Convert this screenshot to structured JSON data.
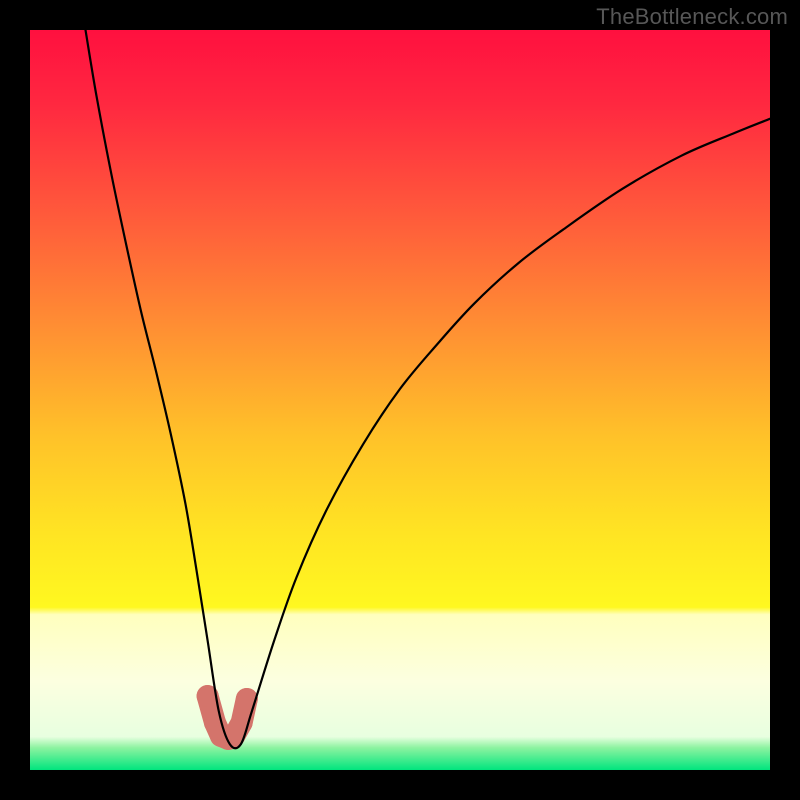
{
  "watermark": "TheBottleneck.com",
  "chart_data": {
    "type": "line",
    "title": "",
    "xlabel": "",
    "ylabel": "",
    "xlim": [
      0,
      100
    ],
    "ylim": [
      0,
      100
    ],
    "background": {
      "kind": "vertical-gradient",
      "stops": [
        {
          "offset": 0.0,
          "color": "#ff103f"
        },
        {
          "offset": 0.1,
          "color": "#ff2840"
        },
        {
          "offset": 0.25,
          "color": "#ff5a3b"
        },
        {
          "offset": 0.4,
          "color": "#ff8e33"
        },
        {
          "offset": 0.55,
          "color": "#ffc229"
        },
        {
          "offset": 0.68,
          "color": "#ffe423"
        },
        {
          "offset": 0.78,
          "color": "#fff820"
        },
        {
          "offset": 0.79,
          "color": "#ffffbe"
        },
        {
          "offset": 0.88,
          "color": "#fcffe0"
        },
        {
          "offset": 0.955,
          "color": "#e8ffe0"
        },
        {
          "offset": 0.97,
          "color": "#8cf3a0"
        },
        {
          "offset": 1.0,
          "color": "#00e57e"
        }
      ]
    },
    "series": [
      {
        "name": "bottleneck-curve",
        "color": "#000000",
        "stroke_width": 2.2,
        "x": [
          7.5,
          9,
          11,
          13,
          15,
          17,
          19,
          21,
          22.5,
          24,
          25.5,
          27,
          28.5,
          30,
          33,
          36,
          40,
          45,
          50,
          55,
          60,
          66,
          72,
          80,
          88,
          95,
          100
        ],
        "y": [
          100,
          91,
          80.5,
          71,
          62,
          54,
          45.5,
          36,
          27,
          17.5,
          8,
          3.5,
          3.5,
          8,
          17.5,
          26,
          35,
          44,
          51.5,
          57.5,
          63,
          68.5,
          73,
          78.5,
          83,
          86,
          88
        ]
      }
    ],
    "highlight": {
      "name": "bottleneck-minimum-band",
      "color": "#d4746b",
      "x": [
        24.0,
        25.0,
        25.8,
        26.8,
        27.6,
        28.6,
        29.3
      ],
      "y": [
        10.0,
        6.4,
        4.6,
        4.2,
        4.6,
        6.4,
        9.6
      ],
      "point_radius": 11,
      "stroke_width": 22
    }
  }
}
